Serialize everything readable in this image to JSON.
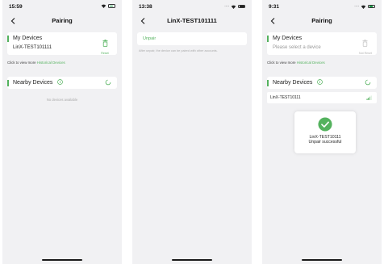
{
  "screens": [
    {
      "status_time": "15:59",
      "nav_title": "Pairing",
      "my_devices": {
        "title": "My Devices",
        "device": "LinX-TEST101111",
        "reset_label": "Reset"
      },
      "history": {
        "prefix": "Click to view more ",
        "link": "Historical Devices"
      },
      "nearby": {
        "title": "Nearby Devices",
        "empty_text": "No devices available"
      }
    },
    {
      "status_time": "13:38",
      "nav_title": "LinX-TEST101111",
      "unpair_label": "Unpair",
      "unpair_hint": "After unpair, the device can be paired with other accounts."
    },
    {
      "status_time": "9:31",
      "nav_title": "Pairing",
      "my_devices": {
        "title": "My Devices",
        "placeholder": "Please select a device",
        "reset_label": "Not Reset"
      },
      "history": {
        "prefix": "Click to view more ",
        "link": "Historical Devices"
      },
      "nearby": {
        "title": "Nearby Devices",
        "found_device": "LinX-TEST10111"
      },
      "toast": {
        "line1": "LinX-TEST10111",
        "line2": "Unpair successful"
      }
    }
  ],
  "colors": {
    "accent": "#54b25e",
    "background": "#f1f1f3",
    "card": "#ffffff",
    "muted_text": "#aaaaaa"
  },
  "icons": {
    "back": "chevron-left-icon",
    "reset": "trash-icon",
    "info": "info-circle-icon",
    "refresh": "spinner-icon",
    "signal": "signal-icon",
    "success": "check-circle-icon"
  }
}
